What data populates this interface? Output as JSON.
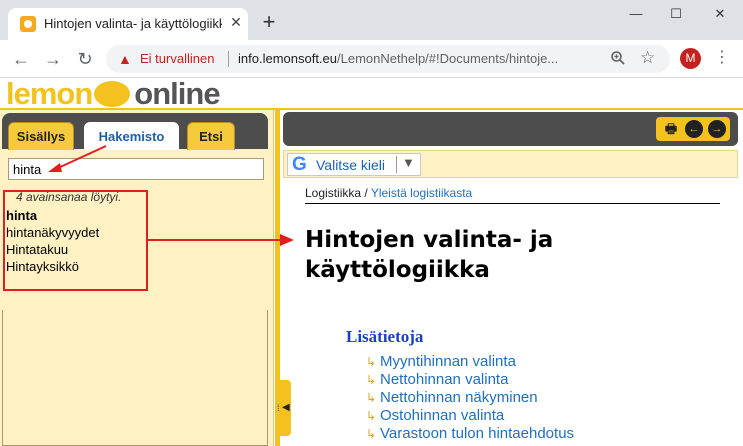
{
  "browser": {
    "tab_title": "Hintojen valinta- ja käyttölogiikka",
    "tab_close": "✕",
    "new_tab": "+",
    "window_minimize": "—",
    "window_maximize": "☐",
    "window_close": "✕",
    "security_text": "Ei turvallinen",
    "url_host": "info.lemonsoft.eu",
    "url_path": "/LemonNethelp/#!Documents/hintoje...",
    "profile_initial": "M"
  },
  "app": {
    "logo_left": "lemon",
    "logo_right": "online"
  },
  "left_panel": {
    "tabs": [
      {
        "label": "Sisällys"
      },
      {
        "label": "Hakemisto"
      },
      {
        "label": "Etsi"
      }
    ],
    "search_value": "hinta",
    "result_count": "4 avainsanaa löytyi.",
    "results": [
      "hinta",
      "hintanäkyvyydet",
      "Hintatakuu",
      "Hintayksikkö"
    ]
  },
  "language": {
    "label": "Valitse kieli",
    "caret": "▼"
  },
  "content": {
    "breadcrumb_root": "Logistiikka",
    "breadcrumb_sep": " / ",
    "breadcrumb_link": "Yleistä logistiikasta",
    "title_line1": "Hintojen valinta- ja",
    "title_line2": "käyttölogiikka",
    "more_heading": "Lisätietoja",
    "links": [
      "Myyntihinnan valinta",
      "Nettohinnan valinta",
      "Nettohinnan näkyminen",
      "Ostohinnan valinta",
      "Varastoon tulon hintaehdotus"
    ]
  },
  "colors": {
    "accent_yellow": "#f3c21f",
    "panel_bg": "#fef2c4",
    "toolbar_dark": "#4d4d4d",
    "link_blue": "#1f6fbf",
    "annotation_red": "#e02020"
  }
}
